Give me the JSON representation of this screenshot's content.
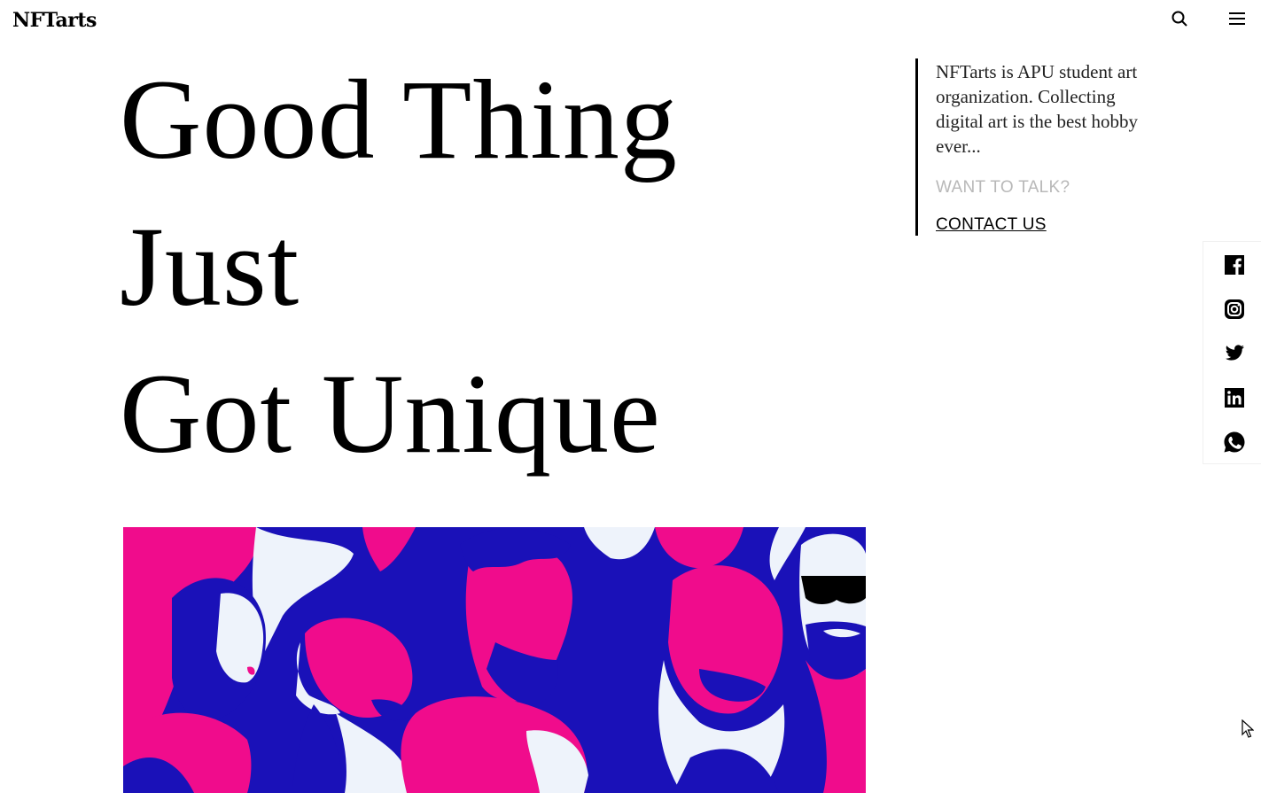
{
  "header": {
    "logo": "NFTarts",
    "search_icon": "search-icon",
    "menu_icon": "menu-icon"
  },
  "hero": {
    "lines": [
      "Good Thing",
      "Just",
      "Got Unique"
    ]
  },
  "about": {
    "text": "NFTarts is APU student art organization. Collecting digital art is the best hobby ever...",
    "prompt": "WANT TO TALK?",
    "contact_link": "CONTACT US"
  },
  "social": {
    "items": [
      "facebook-icon",
      "instagram-icon",
      "twitter-icon",
      "linkedin-icon",
      "whatsapp-icon"
    ]
  },
  "colors": {
    "magenta": "#f00c8c",
    "blue": "#1a11b8",
    "pale": "#eef3fb",
    "ink": "#000000",
    "muted": "#b8b8b8"
  }
}
